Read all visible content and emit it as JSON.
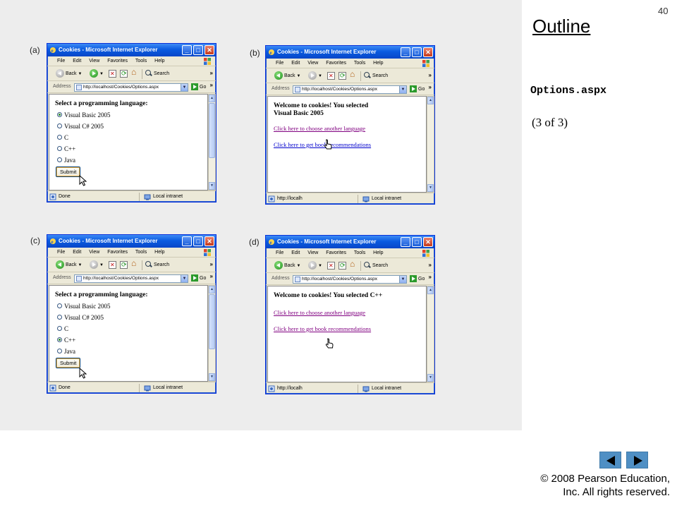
{
  "slide": {
    "page_number": "40",
    "outline_title": "Outline",
    "file_label": "Options.aspx",
    "part_label": "(3 of 3)",
    "copyright_line1": "© 2008 Pearson Education,",
    "copyright_line2": "Inc.  All rights reserved.",
    "nav": {
      "prev_icon": "triangle-left-icon",
      "next_icon": "triangle-right-icon",
      "color": "#4f8fc4"
    }
  },
  "browser": {
    "title": "Cookies - Microsoft Internet Explorer",
    "menu": [
      "File",
      "Edit",
      "View",
      "Favorites",
      "Tools",
      "Help"
    ],
    "toolbar": {
      "back": "Back",
      "search": "Search"
    },
    "address_label": "Address",
    "address_url": "http://localhost/Cookies/Options.aspx",
    "go_label": "Go",
    "zone": "Local intranet",
    "title_color": "#0a5be0"
  },
  "panels": [
    {
      "label": "(a)",
      "type": "form",
      "heading": "Select a programming language:",
      "options": [
        {
          "label": "Visual Basic 2005",
          "checked": true
        },
        {
          "label": "Visual C# 2005",
          "checked": false
        },
        {
          "label": "C",
          "checked": false
        },
        {
          "label": "C++",
          "checked": false
        },
        {
          "label": "Java",
          "checked": false
        }
      ],
      "submit": "Submit",
      "status": "Done"
    },
    {
      "label": "(b)",
      "type": "welcome",
      "welcome_line1": "Welcome to cookies! You selected",
      "welcome_line2": "Visual Basic 2005",
      "link_choose": "Click here to choose another language",
      "link_books": "Click here to get book recommendations",
      "status": "http://localh"
    },
    {
      "label": "(c)",
      "type": "form",
      "heading": "Select a programming language:",
      "options": [
        {
          "label": "Visual Basic 2005",
          "checked": false
        },
        {
          "label": "Visual C# 2005",
          "checked": false
        },
        {
          "label": "C",
          "checked": false
        },
        {
          "label": "C++",
          "checked": true
        },
        {
          "label": "Java",
          "checked": false
        }
      ],
      "submit": "Submit",
      "status": "Done"
    },
    {
      "label": "(d)",
      "type": "welcome",
      "welcome_line1": "Welcome to cookies! You selected C++",
      "welcome_line2": "",
      "link_choose": "Click here to choose another language",
      "link_books": "Click here to get book recommendations",
      "status": "http://localh"
    }
  ]
}
